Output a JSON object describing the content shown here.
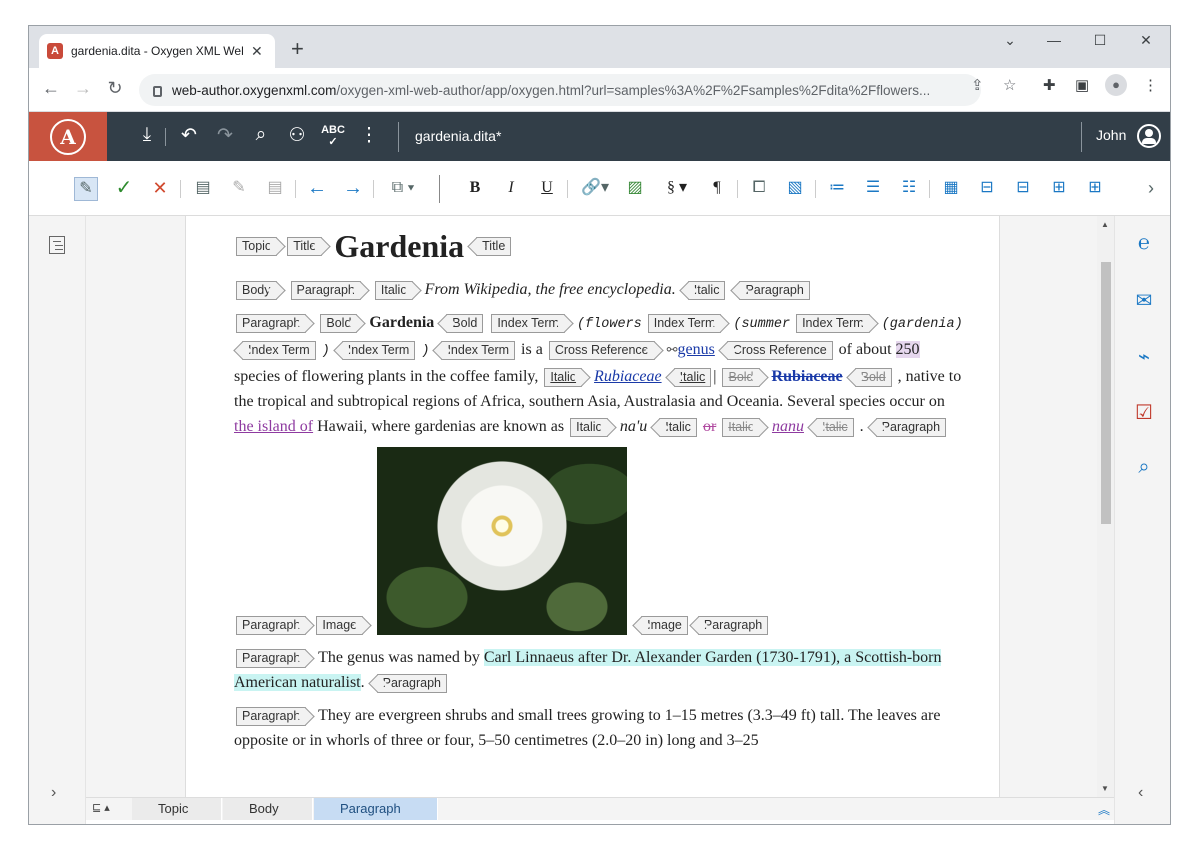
{
  "browser": {
    "tab_title": "gardenia.dita - Oxygen XML Web Author",
    "tab_favicon_letter": "A",
    "url_host": "web-author.oxygenxml.com",
    "url_path": "/oxygen-xml-web-author/app/oxygen.html?url=samples%3A%2F%2Fsamples%2Fdita%2Fflowers..."
  },
  "app": {
    "logo_letter": "A",
    "document_name": "gardenia.dita*",
    "user_name": "John"
  },
  "doc": {
    "title": "Gardenia",
    "tags": {
      "topic": "Topic",
      "title": "Title",
      "body": "Body",
      "paragraph": "Paragraph",
      "italic": "Italic",
      "bold": "Bold",
      "index_term": "Index Term",
      "cross_reference": "Cross Reference",
      "image": "Image"
    },
    "shortdesc": "From Wikipedia, the free encyclopedia.",
    "p1": {
      "bold_name": "Gardenia",
      "it_open": "(flowers",
      "it_summer": "(summer",
      "it_gardenia": "(gardenia)",
      "paren_a": ")",
      "paren_b": ")",
      "is_a": "is a",
      "genus_link": "genus",
      "of_about": "of about",
      "count": "250",
      "species_line": "species of flowering plants in the coffee family,",
      "rubiaceae_ins": "Rubiaceae",
      "rubiaceae_bold": "Rubiaceae",
      "comma": ",",
      "native_line": "native to the tropical and subtropical regions of Africa, southern Asia, Australasia and Oceania. Several",
      "species_occur": "species occur on",
      "island_link": "the island of",
      "hawaii": "Hawaii, where gardenias are known as",
      "naau": "na'u",
      "or_deleted": "or",
      "nanu": "nanu",
      "period": "."
    },
    "p2": {
      "lead": "The genus was named by",
      "highlight": "Carl Linnaeus after Dr. Alexander Garden (1730-1791), a Scottish-born American naturalist",
      "end": "."
    },
    "p3": {
      "line1": "They are evergreen shrubs and small trees growing to 1–15 metres (3.3–49 ft) tall. The",
      "line2": "leaves are opposite or in whorls of three or four, 5–50 centimetres (2.0–20 in) long and 3–25"
    }
  },
  "breadcrumb": [
    "Topic",
    "Body",
    "Paragraph"
  ]
}
